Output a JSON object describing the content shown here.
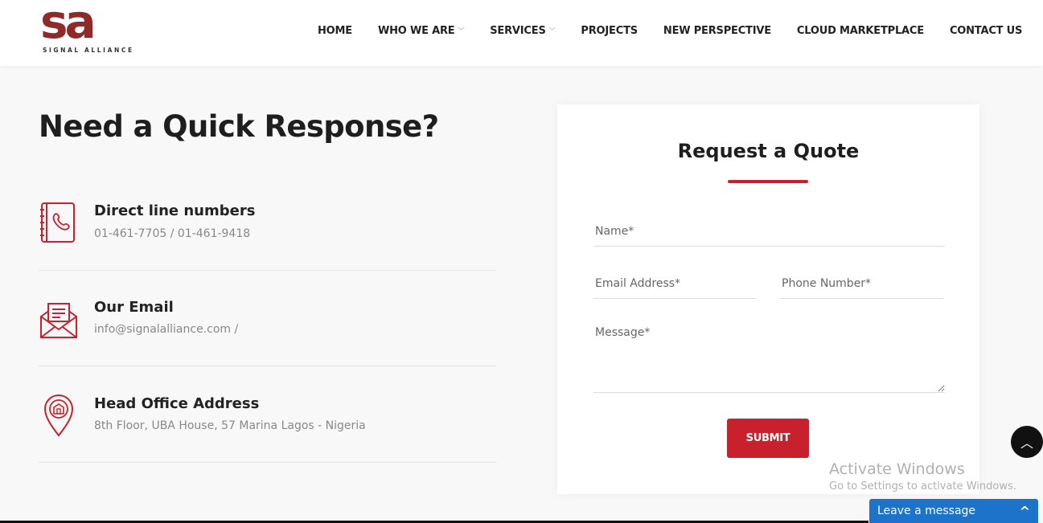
{
  "brand": {
    "logo_text": "sa",
    "logo_subtitle": "SIGNAL ALLIANCE",
    "color": "#8e2a2a"
  },
  "nav": {
    "items": [
      {
        "label": "HOME",
        "dropdown": false
      },
      {
        "label": "WHO WE ARE",
        "dropdown": true
      },
      {
        "label": "SERVICES",
        "dropdown": true
      },
      {
        "label": "PROJECTS",
        "dropdown": false
      },
      {
        "label": "NEW PERSPECTIVE",
        "dropdown": false
      },
      {
        "label": "CLOUD MARKETPLACE",
        "dropdown": false
      },
      {
        "label": "CONTACT US",
        "dropdown": false
      }
    ]
  },
  "main": {
    "title": "Need a Quick Response?",
    "contacts": [
      {
        "icon": "phone-book-icon",
        "heading": "Direct line numbers",
        "text": "01-461-7705 / 01-461-9418"
      },
      {
        "icon": "email-envelope-icon",
        "heading": "Our Email",
        "text": "info@signalalliance.com /"
      },
      {
        "icon": "location-pin-icon",
        "heading": "Head Office Address",
        "text": "8th Floor, UBA House, 57 Marina Lagos - Nigeria"
      }
    ]
  },
  "quote_form": {
    "title": "Request a Quote",
    "name_placeholder": "Name*",
    "email_placeholder": "Email Address*",
    "phone_placeholder": "Phone Number*",
    "message_placeholder": "Message*",
    "submit_label": "SUBMIT"
  },
  "overlay": {
    "activate_title": "Activate Windows",
    "activate_sub": "Go to Settings to activate Windows.",
    "chat_label": "Leave a message"
  },
  "colors": {
    "accent": "#c8202c",
    "chat": "#1d72c9"
  }
}
